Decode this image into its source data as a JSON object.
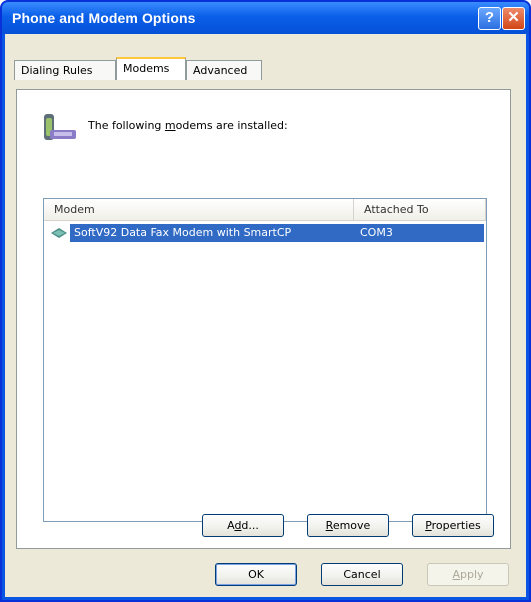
{
  "window": {
    "title": "Phone and Modem Options",
    "help_glyph": "?",
    "close_glyph": "✕"
  },
  "tabs": [
    {
      "label": "Dialing Rules",
      "active": false
    },
    {
      "label": "Modems",
      "active": true
    },
    {
      "label": "Advanced",
      "active": false
    }
  ],
  "modems_tab": {
    "header_icon": "phone-modem-icon",
    "intro_prefix": "The following ",
    "intro_accel": "m",
    "intro_suffix": "odems are installed:",
    "columns": [
      "Modem",
      "Attached To"
    ],
    "rows": [
      {
        "icon": "modem-icon",
        "modem": "SoftV92 Data Fax Modem with SmartCP",
        "attached_to": "COM3",
        "selected": true
      }
    ],
    "buttons": {
      "add_prefix": "A",
      "add_accel": "d",
      "add_suffix": "d...",
      "remove_accel": "R",
      "remove_suffix": "emove",
      "properties_accel": "P",
      "properties_suffix": "roperties"
    }
  },
  "footer": {
    "ok": "OK",
    "cancel": "Cancel",
    "apply_accel": "A",
    "apply_suffix": "pply",
    "apply_enabled": false
  },
  "colors": {
    "titlebar": "#0a5fe8",
    "dialog_bg": "#ece9d8",
    "selection": "#316ac5"
  }
}
